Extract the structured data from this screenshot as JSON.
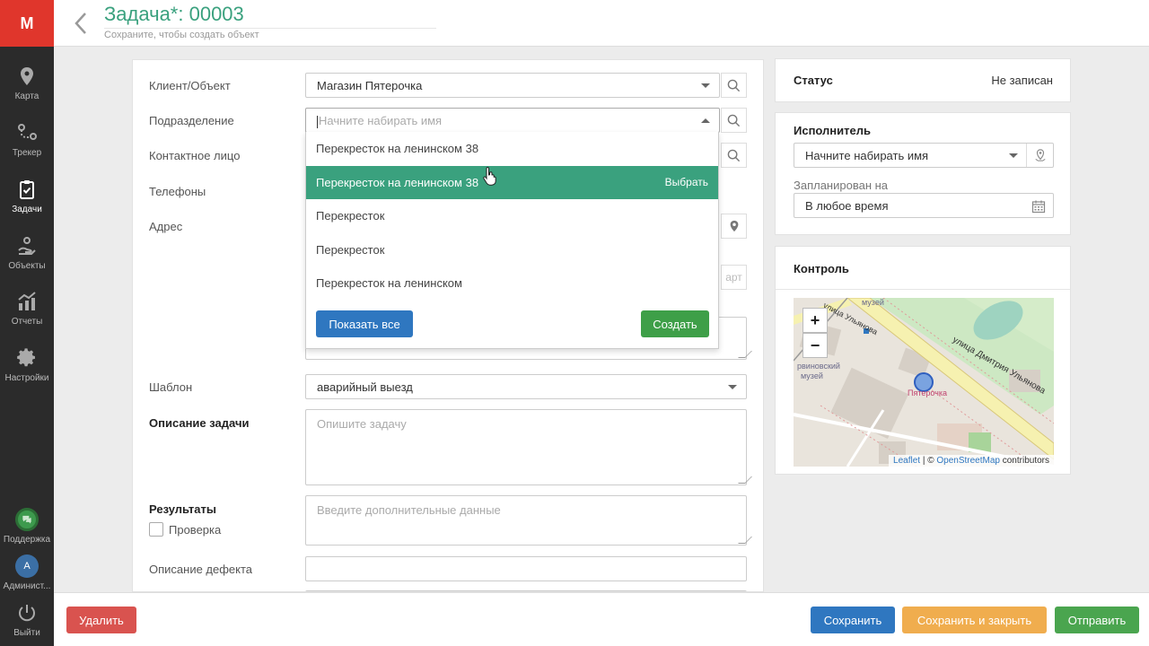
{
  "app": {
    "logo": "M"
  },
  "sidebar": {
    "items": [
      {
        "label": "Карта",
        "icon": "map-pin-icon"
      },
      {
        "label": "Трекер",
        "icon": "route-icon"
      },
      {
        "label": "Задачи",
        "icon": "clipboard-check-icon",
        "active": true
      },
      {
        "label": "Объекты",
        "icon": "objects-icon"
      },
      {
        "label": "Отчеты",
        "icon": "chart-icon"
      },
      {
        "label": "Настройки",
        "icon": "gear-icon"
      }
    ],
    "support_label": "Поддержка",
    "admin_initial": "A",
    "admin_label": "Админист...",
    "logout_label": "Выйти"
  },
  "header": {
    "title": "Задача*: 00003",
    "subtitle": "Сохраните, чтобы создать объект"
  },
  "form": {
    "client_label": "Клиент/Объект",
    "client_value": "Магазин Пятерочка",
    "division_label": "Подразделение",
    "division_placeholder": "Начните набирать имя",
    "contact_label": "Контактное лицо",
    "phones_label": "Телефоны",
    "address_label": "Адрес",
    "address_hint": "арт",
    "template_label": "Шаблон",
    "template_value": "аварийный выезд",
    "description_label": "Описание задачи",
    "description_placeholder": "Опишите задачу",
    "results_label": "Результаты",
    "results_placeholder": "Введите дополнительные данные",
    "check_label": "Проверка",
    "defect_label": "Описание дефекта"
  },
  "dropdown": {
    "items": [
      "Перекресток на ленинском 38",
      "Перекресток на ленинском 38",
      "Перекресток",
      "Перекресток",
      "Перекресток на ленинском"
    ],
    "active_index": 1,
    "pick_label": "Выбрать",
    "show_all_label": "Показать все",
    "create_label": "Создать"
  },
  "status": {
    "title": "Статус",
    "value": "Не записан"
  },
  "executor": {
    "title": "Исполнитель",
    "placeholder": "Начните набирать имя",
    "planned_label": "Запланирован на",
    "planned_value": "В любое время"
  },
  "control": {
    "title": "Контроль",
    "map": {
      "zoom_in": "+",
      "zoom_out": "−",
      "labels": {
        "museum_top": "музей",
        "street1": "улица Ульянова",
        "street2": "улица Дмитрия Ульянова",
        "museum_left1": "рвиновский",
        "museum_left2": "музей",
        "shop": "Пятерочка"
      },
      "attribution_leaflet": "Leaflet",
      "attribution_sep": " | © ",
      "attribution_osm": "OpenStreetMap",
      "attribution_tail": " contributors"
    }
  },
  "footer": {
    "delete_label": "Удалить",
    "save_label": "Сохранить",
    "save_close_label": "Сохранить и закрыть",
    "send_label": "Отправить"
  },
  "colors": {
    "accent": "#3aa17e",
    "logo": "#e0362c",
    "primary": "#2f77c0",
    "danger": "#d9534f",
    "warning": "#f0ad4e",
    "success": "#4aa54f"
  }
}
